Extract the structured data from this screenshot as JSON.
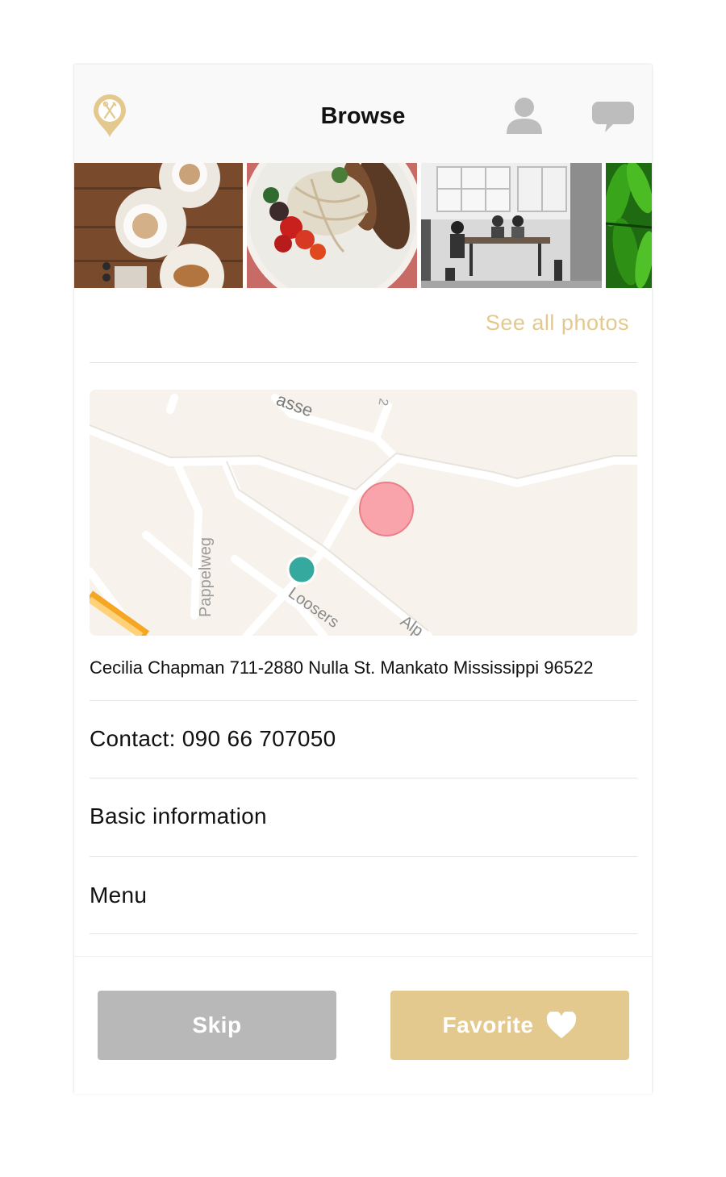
{
  "header": {
    "title": "Browse",
    "icons": [
      "restaurant-pin-logo-icon",
      "profile-icon",
      "chat-icon"
    ]
  },
  "photos": {
    "items": [
      {
        "subject": "coffee-cups-on-table"
      },
      {
        "subject": "salad-bowl"
      },
      {
        "subject": "cafe-interior"
      },
      {
        "subject": "green-peppers"
      }
    ],
    "see_all_label": "See all photos"
  },
  "map": {
    "street_labels": [
      "asse",
      "Pappelweg",
      "Loosers",
      "Alp",
      "2"
    ],
    "pin_colors": {
      "destination": "#f9a3ab",
      "current": "#35a99d"
    }
  },
  "details": {
    "address": "Cecilia Chapman 711-2880 Nulla St. Mankato Mississippi 96522",
    "contact": "Contact: 090 66 707050",
    "basic_info": "Basic information",
    "menu": "Menu"
  },
  "actions": {
    "skip_label": "Skip",
    "favorite_label": "Favorite"
  },
  "colors": {
    "accent": "#e3c98e",
    "skip_button": "#b8b8b8",
    "header_bg": "#f9f9f9"
  }
}
